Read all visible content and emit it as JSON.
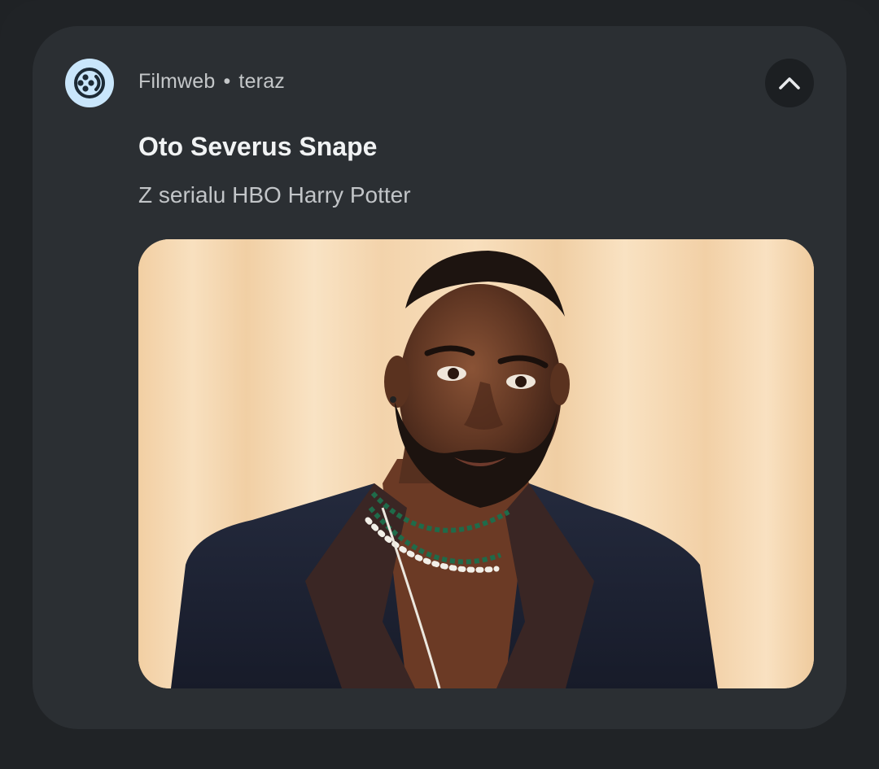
{
  "notification": {
    "app_name": "Filmweb",
    "separator": "•",
    "time": "teraz",
    "title": "Oto Severus Snape",
    "text": "Z serialu HBO Harry Potter",
    "app_icon": "filmweb-reel-icon",
    "collapse_icon": "chevron-up-icon",
    "image": "portrait-photo"
  },
  "colors": {
    "card_bg": "#2b2f33",
    "app_icon_bg": "#c9e6fb",
    "title": "#f1f3f4",
    "secondary_text": "#c4c7c9"
  }
}
